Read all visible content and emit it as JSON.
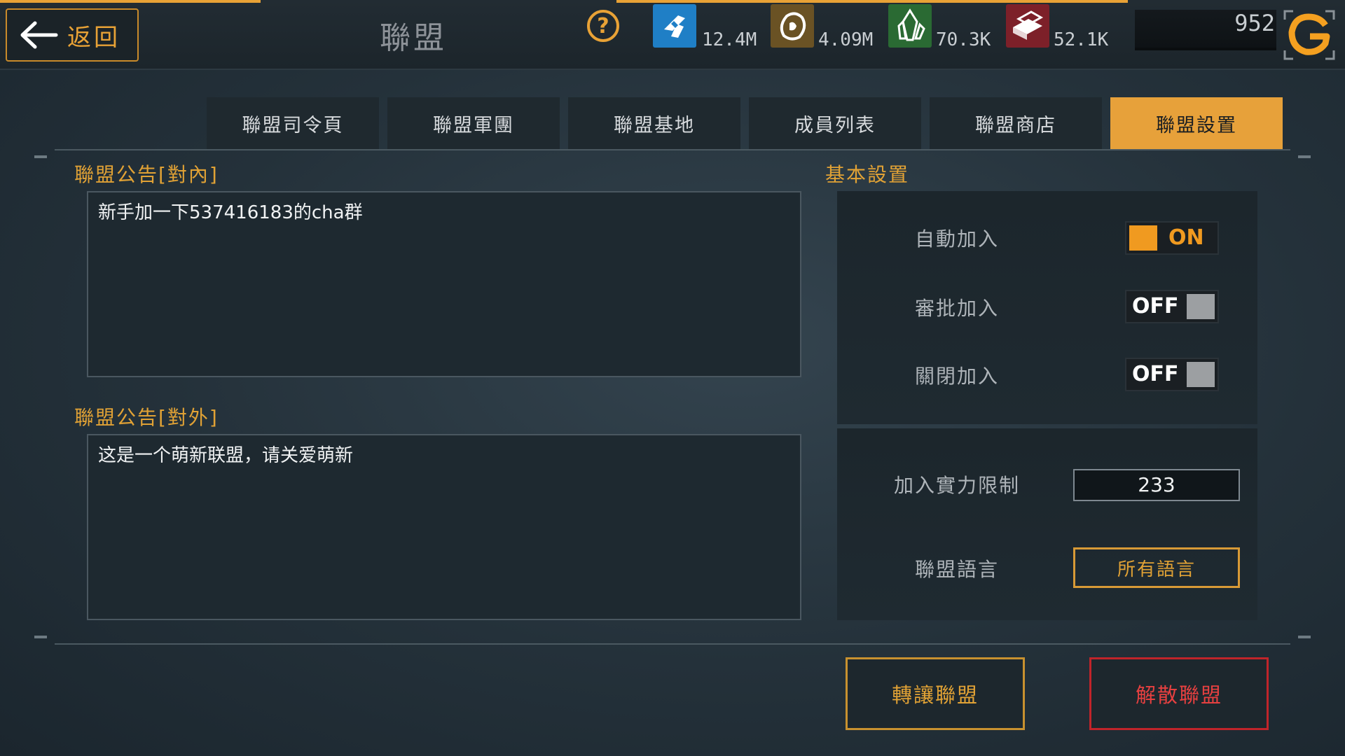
{
  "header": {
    "back_label": "返回",
    "title": "聯盟",
    "help_glyph": "?",
    "resources": [
      {
        "name": "energy-icon",
        "value": "12.4M",
        "color": "#1f7fc6"
      },
      {
        "name": "ore-icon",
        "value": "4.09M",
        "color": "#7a5c28"
      },
      {
        "name": "crystal-icon",
        "value": "70.3K",
        "color": "#2f7a3a"
      },
      {
        "name": "alloy-icon",
        "value": "52.1K",
        "color": "#8a2630"
      }
    ],
    "gold_value": "952"
  },
  "tabs": [
    {
      "label": "聯盟司令頁",
      "active": false
    },
    {
      "label": "聯盟軍團",
      "active": false
    },
    {
      "label": "聯盟基地",
      "active": false
    },
    {
      "label": "成員列表",
      "active": false
    },
    {
      "label": "聯盟商店",
      "active": false
    },
    {
      "label": "聯盟設置",
      "active": true
    }
  ],
  "notices": {
    "internal_title": "聯盟公告[對內]",
    "internal_text": "新手加一下537416183的cha群",
    "external_title": "聯盟公告[對外]",
    "external_text": "这是一个萌新联盟，请关爱萌新"
  },
  "settings": {
    "title": "基本設置",
    "auto_join": {
      "label": "自動加入",
      "state": "ON"
    },
    "approve_join": {
      "label": "審批加入",
      "state": "OFF"
    },
    "close_join": {
      "label": "關閉加入",
      "state": "OFF"
    },
    "power_limit_label": "加入實力限制",
    "power_limit_value": "233",
    "language_label": "聯盟語言",
    "language_value": "所有語言"
  },
  "actions": {
    "transfer_label": "轉讓聯盟",
    "disband_label": "解散聯盟"
  },
  "colors": {
    "accent": "#e7a13a",
    "danger": "#c0242a"
  }
}
